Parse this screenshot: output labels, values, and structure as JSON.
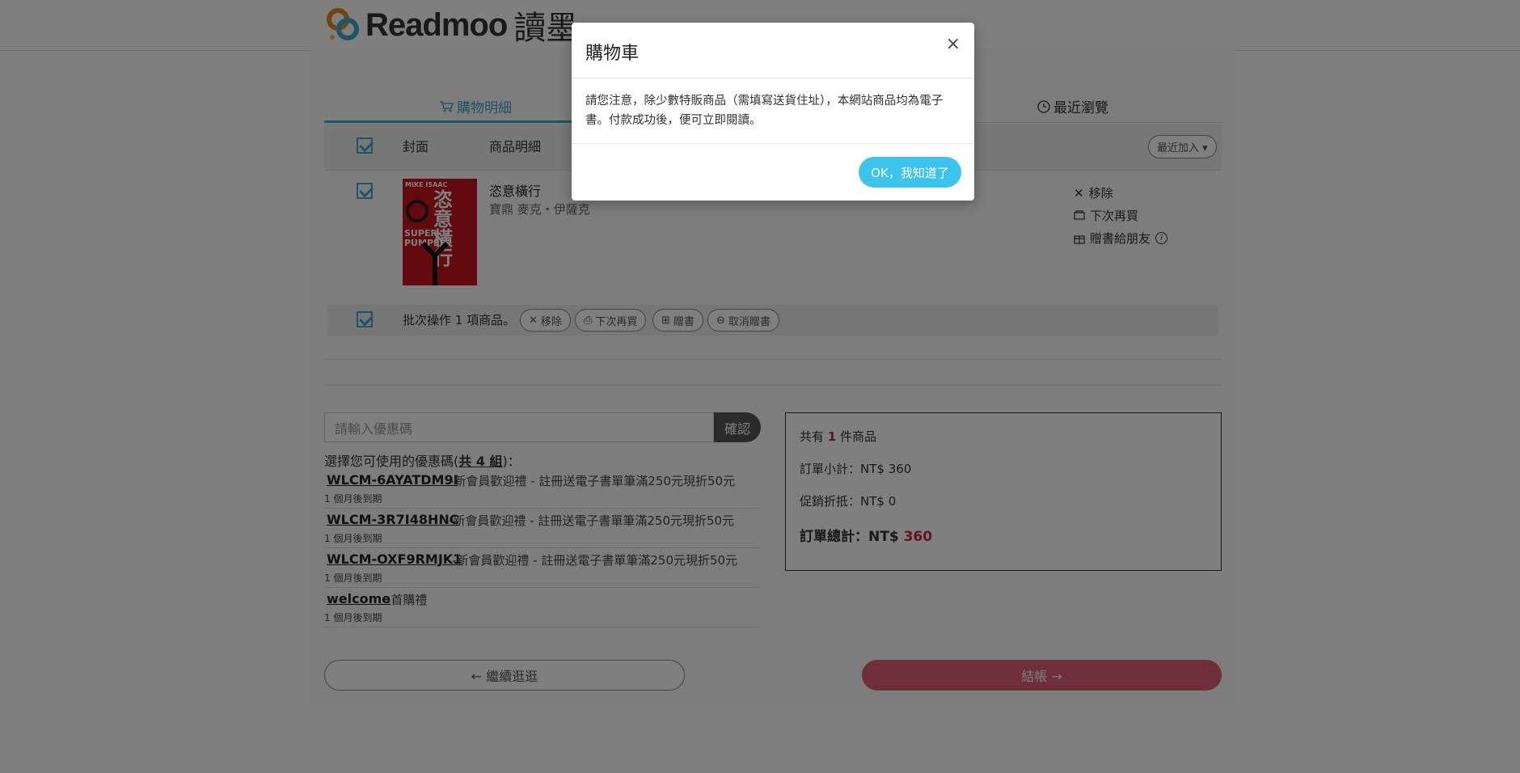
{
  "brand": {
    "logo_text": "Readmoo",
    "logo_cn": "讀墨"
  },
  "tabs": [
    {
      "label": "購物明細",
      "icon": "cart-icon"
    },
    {
      "label": "最近瀏覽",
      "icon": "clock-icon"
    }
  ],
  "table": {
    "headers": {
      "cover": "封面",
      "detail": "商品明細"
    },
    "sort_label": "最近加入"
  },
  "item": {
    "title": "恣意橫行",
    "author": "寶鼎 麥克・伊薩克",
    "cover_texts": [
      "MIKE ISAAC",
      "恣意橫行",
      "SUPER PUMPED"
    ],
    "actions": {
      "remove": "移除",
      "later": "下次再買",
      "gift": "贈書給朋友"
    }
  },
  "batch": {
    "text": "批次操作 1 項商品。",
    "remove": "移除",
    "later": "下次再買",
    "gift": "贈書",
    "cancel_gift": "取消贈書"
  },
  "coupon": {
    "placeholder": "請輸入優惠碼",
    "confirm": "確認",
    "list_prefix": "選擇您可使用的優惠碼(",
    "list_count": "共 4 組",
    "list_suffix": ")：",
    "items": [
      {
        "code": "WLCM-6AYATDM9I",
        "desc": "-新會員歡迎禮 - 註冊送電子書單筆滿250元現折50元",
        "expiry": "1 個月後到期"
      },
      {
        "code": "WLCM-3R7I48HNC",
        "desc": "-新會員歡迎禮 - 註冊送電子書單筆滿250元現折50元",
        "expiry": "1 個月後到期"
      },
      {
        "code": "WLCM-OXF9RMJK1",
        "desc": "-新會員歡迎禮 - 註冊送電子書單筆滿250元現折50元",
        "expiry": "1 個月後到期"
      },
      {
        "code": "welcome",
        "desc": "-首購禮",
        "expiry": "1 個月後到期"
      }
    ]
  },
  "summary": {
    "count_prefix": "共有 ",
    "count": "1",
    "count_suffix": " 件商品",
    "subtotal": "訂單小計：NT$ 360",
    "discount": "促銷折抵：NT$ 0",
    "total_label": "訂單總計：NT$ ",
    "total_value": "360"
  },
  "footer": {
    "continue": "← 繼續逛逛",
    "checkout": "結帳 →"
  },
  "modal": {
    "title": "購物車",
    "close": "×",
    "body": "請您注意，除少數特販商品（需填寫送貨住址），本網站商品均為電子書。付款成功後，便可立即閱讀。",
    "ok": "OK，我知道了"
  },
  "colors": {
    "accent": "#3fa8c9",
    "checkout": "#dc5d74",
    "highlight": "#c9243f",
    "ok_button": "#3cc4ec"
  }
}
